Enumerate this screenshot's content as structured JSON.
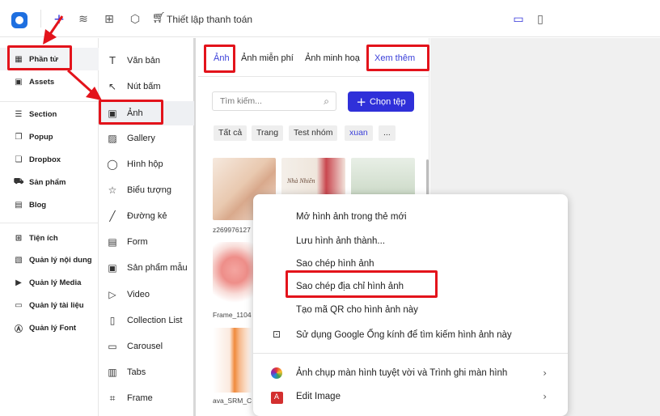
{
  "topbar": {
    "title": "Thiết lập thanh toán",
    "icons": [
      "app-logo",
      "plus-icon",
      "layers-icon",
      "grid-icon",
      "cube-icon",
      "cart-icon",
      "desktop-icon",
      "mobile-icon"
    ]
  },
  "sidebar": {
    "items": [
      {
        "label": "Phần tử",
        "icon": "elements-icon"
      },
      {
        "label": "Assets",
        "icon": "image-icon"
      },
      {
        "label": "Section",
        "icon": "section-icon"
      },
      {
        "label": "Popup",
        "icon": "popup-icon"
      },
      {
        "label": "Dropbox",
        "icon": "dropbox-icon"
      },
      {
        "label": "Sản phẩm",
        "icon": "cart-icon"
      },
      {
        "label": "Blog",
        "icon": "blog-icon"
      },
      {
        "label": "Tiện ích",
        "icon": "grid-icon"
      },
      {
        "label": "Quản lý nội dung",
        "icon": "content-icon"
      },
      {
        "label": "Quản lý Media",
        "icon": "media-icon"
      },
      {
        "label": "Quản lý tài liệu",
        "icon": "folder-icon"
      },
      {
        "label": "Quản lý Font",
        "icon": "font-icon"
      }
    ]
  },
  "elements": {
    "items": [
      {
        "label": "Văn bản",
        "icon": "text-icon"
      },
      {
        "label": "Nút bấm",
        "icon": "cursor-icon"
      },
      {
        "label": "Ảnh",
        "icon": "image-icon"
      },
      {
        "label": "Gallery",
        "icon": "gallery-icon"
      },
      {
        "label": "Hình hộp",
        "icon": "box-icon"
      },
      {
        "label": "Biểu tượng",
        "icon": "star-icon"
      },
      {
        "label": "Đường kẻ",
        "icon": "line-icon"
      },
      {
        "label": "Form",
        "icon": "form-icon"
      },
      {
        "label": "Sản phẩm mẫu",
        "icon": "product-icon"
      },
      {
        "label": "Video",
        "icon": "video-icon"
      },
      {
        "label": "Collection List",
        "icon": "collection-icon"
      },
      {
        "label": "Carousel",
        "icon": "carousel-icon"
      },
      {
        "label": "Tabs",
        "icon": "tabs-icon"
      },
      {
        "label": "Frame",
        "icon": "frame-icon"
      }
    ]
  },
  "panel": {
    "tabs": [
      "Ảnh",
      "Ảnh miễn phí",
      "Ảnh minh hoạ",
      "Xem thêm"
    ],
    "search_placeholder": "Tìm kiếm...",
    "upload_label": "Chọn tệp",
    "chips": [
      "Tất cả",
      "Trang",
      "Test nhóm",
      "xuan",
      "..."
    ],
    "captions": [
      "z269976127",
      "Frame_1104",
      "ava_SRM_C"
    ],
    "thumbnail_texts": [
      "Nhà Nhiên"
    ]
  },
  "context_menu": {
    "items": [
      {
        "label": "Mở hình ảnh trong thẻ mới"
      },
      {
        "label": "Lưu hình ảnh thành..."
      },
      {
        "label": "Sao chép hình ảnh"
      },
      {
        "label": "Sao chép địa chỉ hình ảnh"
      },
      {
        "label": "Tạo mã QR cho hình ảnh này"
      },
      {
        "label": "Sử dụng Google Ống kính để tìm kiếm hình ảnh này",
        "icon": "google-lens-icon"
      },
      {
        "label": "Ảnh chụp màn hình tuyệt vời và Trình ghi màn hình",
        "icon": "screenshot-extension-icon",
        "submenu": true
      },
      {
        "label": "Edit Image",
        "icon": "pdf-icon",
        "submenu": true
      }
    ]
  },
  "colors": {
    "accent": "#3a3fd9",
    "button": "#2f30d9",
    "highlight": "#e3131b"
  }
}
